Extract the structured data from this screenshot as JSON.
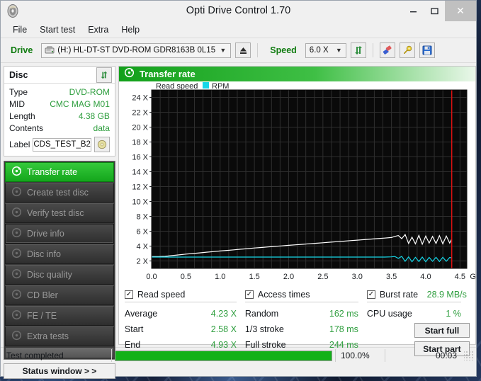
{
  "window": {
    "title": "Opti Drive Control 1.70",
    "app_icon": "disc-icon",
    "minimize": "–",
    "maximize": "☐",
    "close": "✕"
  },
  "menu": {
    "items": [
      "File",
      "Start test",
      "Extra",
      "Help"
    ]
  },
  "toolbar": {
    "drive_label": "Drive",
    "drive_value": "(H:)  HL-DT-ST DVD-ROM GDR8163B 0L15",
    "eject_icon": "eject-icon",
    "speed_label": "Speed",
    "speed_value": "6.0 X",
    "refresh_icon": "refresh-icon",
    "eraser_icon": "eraser-icon",
    "tools_icon": "tools-icon",
    "save_icon": "save-icon"
  },
  "disc": {
    "title": "Disc",
    "refresh_icon": "refresh-icon",
    "rows": [
      {
        "key": "Type",
        "value": "DVD-ROM"
      },
      {
        "key": "MID",
        "value": "CMC MAG M01"
      },
      {
        "key": "Length",
        "value": "4.38 GB"
      },
      {
        "key": "Contents",
        "value": "data"
      }
    ],
    "label_key": "Label",
    "label_value": "CDS_TEST_B2",
    "label_icon": "cd-icon"
  },
  "sidebar": {
    "items": [
      {
        "label": "Transfer rate",
        "icon": "disc-icon",
        "active": true
      },
      {
        "label": "Create test disc",
        "icon": "disc-icon",
        "active": false
      },
      {
        "label": "Verify test disc",
        "icon": "disc-icon",
        "active": false
      },
      {
        "label": "Drive info",
        "icon": "disc-icon",
        "active": false
      },
      {
        "label": "Disc info",
        "icon": "disc-icon",
        "active": false
      },
      {
        "label": "Disc quality",
        "icon": "disc-icon",
        "active": false
      },
      {
        "label": "CD Bler",
        "icon": "disc-icon",
        "active": false
      },
      {
        "label": "FE / TE",
        "icon": "disc-icon",
        "active": false
      },
      {
        "label": "Extra tests",
        "icon": "disc-icon",
        "active": false
      }
    ],
    "status_window_button": "Status window > >"
  },
  "panel": {
    "title": "Transfer rate",
    "icon": "disc-icon"
  },
  "chart_data": {
    "type": "line",
    "title": "Transfer rate",
    "xlabel": "GB",
    "ylabel": "X",
    "xlim": [
      0.0,
      4.6
    ],
    "ylim": [
      1.0,
      25.0
    ],
    "xticks": [
      "0.0",
      "0.5",
      "1.0",
      "1.5",
      "2.0",
      "2.5",
      "3.0",
      "3.5",
      "4.0",
      "4.5"
    ],
    "xtick_values": [
      0.0,
      0.5,
      1.0,
      1.5,
      2.0,
      2.5,
      3.0,
      3.5,
      4.0,
      4.5
    ],
    "x_unit": "GB",
    "yticks": [
      "2 X",
      "4 X",
      "6 X",
      "8 X",
      "10 X",
      "12 X",
      "14 X",
      "16 X",
      "18 X",
      "20 X",
      "22 X",
      "24 X"
    ],
    "ytick_values": [
      2,
      4,
      6,
      8,
      10,
      12,
      14,
      16,
      18,
      20,
      22,
      24
    ],
    "grid": true,
    "legend_position": "top-left",
    "plot_bg": "#0a0a0a",
    "grid_color": "#2f2f2f",
    "end_marker": {
      "x": 4.38,
      "color": "#e01010"
    },
    "legend": [
      {
        "name": "Read speed",
        "color": "#ffffff"
      },
      {
        "name": "RPM",
        "color": "#16d7e8"
      }
    ],
    "series": [
      {
        "name": "Read speed",
        "color": "#ffffff",
        "x": [
          0.0,
          0.1,
          0.2,
          0.3,
          0.4,
          0.5,
          0.6,
          0.7,
          0.8,
          0.9,
          1.0,
          1.1,
          1.2,
          1.3,
          1.4,
          1.5,
          1.6,
          1.7,
          1.8,
          1.9,
          2.0,
          2.1,
          2.2,
          2.3,
          2.4,
          2.5,
          2.6,
          2.7,
          2.8,
          2.9,
          3.0,
          3.1,
          3.2,
          3.3,
          3.4,
          3.5,
          3.55,
          3.6,
          3.65,
          3.7,
          3.75,
          3.8,
          3.85,
          3.9,
          3.95,
          4.0,
          4.05,
          4.1,
          4.15,
          4.2,
          4.25,
          4.3,
          4.35,
          4.38
        ],
        "y": [
          2.58,
          2.58,
          2.62,
          2.72,
          2.82,
          2.92,
          3.0,
          3.09,
          3.18,
          3.26,
          3.34,
          3.42,
          3.5,
          3.58,
          3.66,
          3.74,
          3.81,
          3.89,
          3.96,
          4.03,
          4.1,
          4.17,
          4.24,
          4.31,
          4.38,
          4.45,
          4.52,
          4.59,
          4.66,
          4.73,
          4.8,
          4.87,
          4.94,
          5.01,
          5.08,
          5.15,
          5.3,
          5.42,
          5.0,
          5.55,
          4.35,
          5.2,
          4.3,
          5.45,
          4.25,
          5.35,
          4.4,
          5.3,
          4.35,
          5.4,
          4.3,
          5.35,
          4.4,
          4.93
        ]
      },
      {
        "name": "RPM",
        "color": "#16d7e8",
        "x": [
          0.0,
          0.2,
          0.4,
          0.6,
          0.8,
          1.0,
          1.2,
          1.4,
          1.6,
          1.8,
          2.0,
          2.2,
          2.4,
          2.6,
          2.8,
          3.0,
          3.2,
          3.4,
          3.5,
          3.55,
          3.6,
          3.65,
          3.7,
          3.75,
          3.8,
          3.85,
          3.9,
          3.95,
          4.0,
          4.05,
          4.1,
          4.15,
          4.2,
          4.25,
          4.3,
          4.35,
          4.38
        ],
        "y": [
          2.52,
          2.52,
          2.52,
          2.52,
          2.52,
          2.52,
          2.52,
          2.52,
          2.52,
          2.52,
          2.52,
          2.52,
          2.52,
          2.52,
          2.52,
          2.52,
          2.52,
          2.52,
          2.55,
          2.6,
          2.35,
          2.62,
          1.95,
          2.55,
          1.9,
          2.5,
          1.92,
          2.52,
          1.9,
          2.48,
          1.95,
          2.5,
          1.92,
          2.5,
          1.95,
          2.48,
          2.4
        ]
      }
    ]
  },
  "results": {
    "read_speed": {
      "checkbox_label": "Read speed",
      "checked": true,
      "rows": [
        {
          "key": "Average",
          "value": "4.23 X"
        },
        {
          "key": "Start",
          "value": "2.58 X"
        },
        {
          "key": "End",
          "value": "4.93 X"
        }
      ]
    },
    "access_times": {
      "checkbox_label": "Access times",
      "checked": true,
      "rows": [
        {
          "key": "Random",
          "value": "162 ms"
        },
        {
          "key": "1/3 stroke",
          "value": "178 ms"
        },
        {
          "key": "Full stroke",
          "value": "244 ms"
        }
      ]
    },
    "burst": {
      "checkbox_label": "Burst rate",
      "checked": true,
      "burst_value": "28.9 MB/s",
      "cpu_key": "CPU usage",
      "cpu_value": "1 %",
      "start_full": "Start full",
      "start_part": "Start part"
    }
  },
  "statusbar": {
    "text": "Test completed",
    "progress_percent": "100.0%",
    "progress_value": 100,
    "elapsed": "00:03"
  }
}
